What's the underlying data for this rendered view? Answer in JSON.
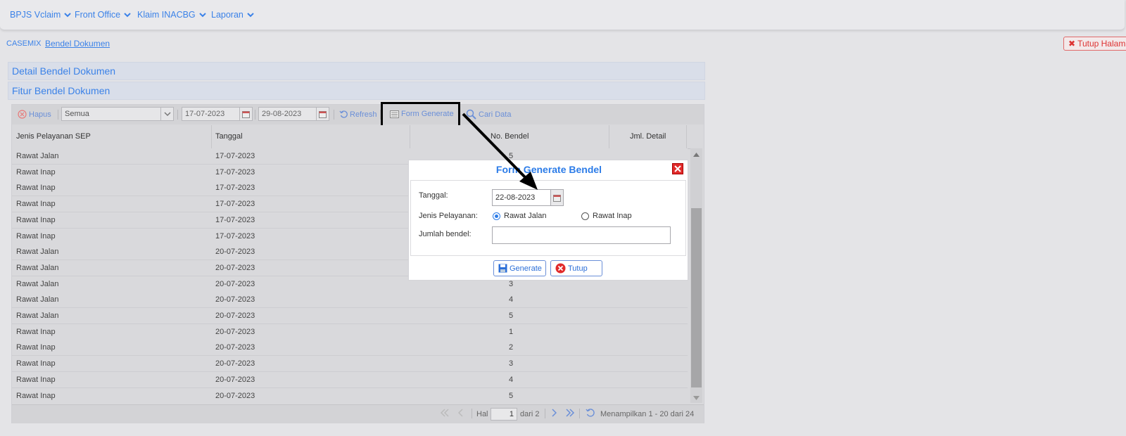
{
  "nav": {
    "items": [
      {
        "label": "BPJS Vclaim"
      },
      {
        "label": "Front Office"
      },
      {
        "label": "Klaim INACBG"
      },
      {
        "label": "Laporan"
      }
    ]
  },
  "breadcrumb": {
    "root": "CASEMIX",
    "current": "Bendel Dokumen"
  },
  "close_page_label": "Tutup Halaman",
  "panels": {
    "detail_title": "Detail Bendel Dokumen",
    "feature_title": "Fitur Bendel Dokumen"
  },
  "toolbar": {
    "delete_label": "Hapus",
    "filter_value": "Semua",
    "date_from": "17-07-2023",
    "date_to": "29-08-2023",
    "refresh_label": "Refresh",
    "form_generate_label": "Form Generate",
    "search_label": "Cari Data"
  },
  "grid": {
    "columns": [
      "Jenis Pelayanan SEP",
      "Tanggal",
      "No. Bendel",
      "Jml. Detail"
    ],
    "rows": [
      {
        "jenis": "Rawat Jalan",
        "tanggal": "17-07-2023",
        "no": "5"
      },
      {
        "jenis": "Rawat Inap",
        "tanggal": "17-07-2023",
        "no": ""
      },
      {
        "jenis": "Rawat Inap",
        "tanggal": "17-07-2023",
        "no": ""
      },
      {
        "jenis": "Rawat Inap",
        "tanggal": "17-07-2023",
        "no": ""
      },
      {
        "jenis": "Rawat Inap",
        "tanggal": "17-07-2023",
        "no": ""
      },
      {
        "jenis": "Rawat Inap",
        "tanggal": "17-07-2023",
        "no": ""
      },
      {
        "jenis": "Rawat Jalan",
        "tanggal": "20-07-2023",
        "no": ""
      },
      {
        "jenis": "Rawat Jalan",
        "tanggal": "20-07-2023",
        "no": ""
      },
      {
        "jenis": "Rawat Jalan",
        "tanggal": "20-07-2023",
        "no": "3"
      },
      {
        "jenis": "Rawat Jalan",
        "tanggal": "20-07-2023",
        "no": "4"
      },
      {
        "jenis": "Rawat Jalan",
        "tanggal": "20-07-2023",
        "no": "5"
      },
      {
        "jenis": "Rawat Inap",
        "tanggal": "20-07-2023",
        "no": "1"
      },
      {
        "jenis": "Rawat Inap",
        "tanggal": "20-07-2023",
        "no": "2"
      },
      {
        "jenis": "Rawat Inap",
        "tanggal": "20-07-2023",
        "no": "3"
      },
      {
        "jenis": "Rawat Inap",
        "tanggal": "20-07-2023",
        "no": "4"
      },
      {
        "jenis": "Rawat Inap",
        "tanggal": "20-07-2023",
        "no": "5"
      }
    ]
  },
  "pager": {
    "page_label": "Hal",
    "page_value": "1",
    "of_label": "dari 2",
    "summary": "Menampilkan 1 - 20 dari 24"
  },
  "modal": {
    "title": "Form Generate Bendel",
    "tanggal_label": "Tanggal:",
    "tanggal_value": "22-08-2023",
    "jenis_label": "Jenis Pelayanan:",
    "opt_jalan": "Rawat Jalan",
    "opt_inap": "Rawat Inap",
    "jumlah_label": "Jumlah bendel:",
    "jumlah_value": "",
    "generate_label": "Generate",
    "close_label": "Tutup"
  },
  "colors": {
    "accent": "#3b82e8",
    "danger": "#e12b2b"
  }
}
